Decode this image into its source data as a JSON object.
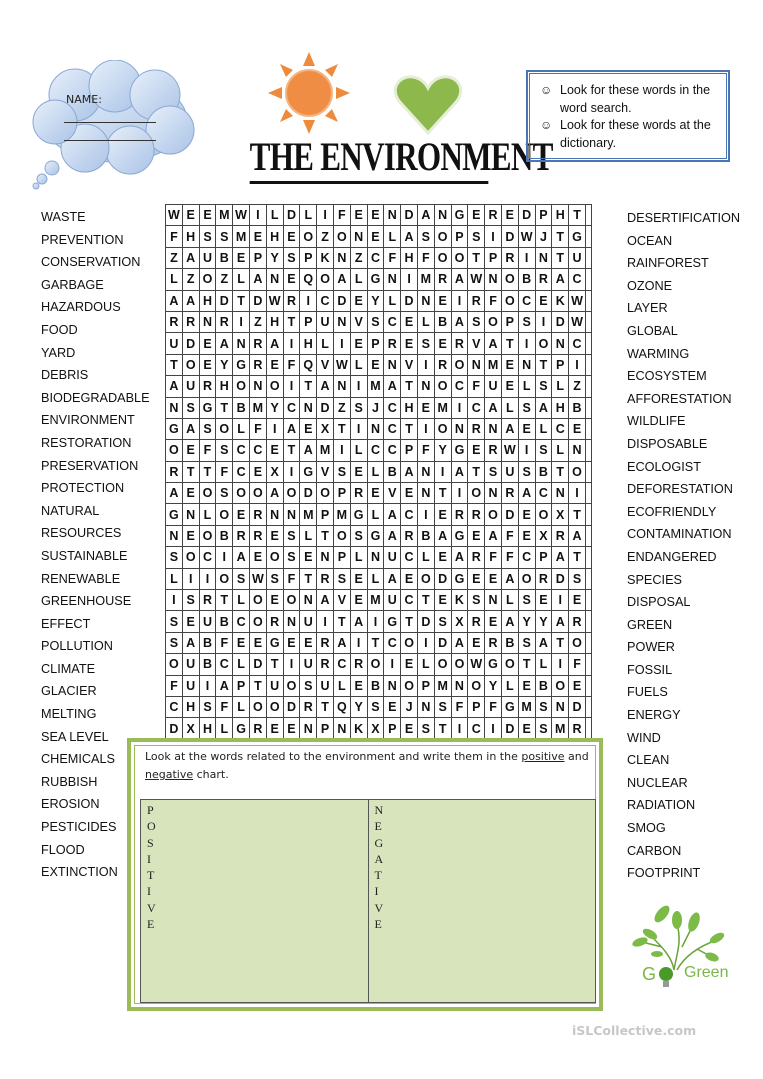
{
  "header": {
    "name_label": "NAME:",
    "title": "THE ENVIRONMENT",
    "instructions": [
      {
        "icon": "smiley-icon",
        "glyph": "☺",
        "text": "Look for these words in the word search."
      },
      {
        "icon": "smiley-icon",
        "glyph": "☺",
        "text": "Look for these words at the dictionary."
      }
    ]
  },
  "left_words": [
    "WASTE",
    "PREVENTION",
    "CONSERVATION",
    "GARBAGE",
    "HAZARDOUS",
    "FOOD",
    "YARD",
    "DEBRIS",
    "BIODEGRADABLE",
    "ENVIRONMENT",
    "RESTORATION",
    "PRESERVATION",
    "PROTECTION",
    "NATURAL",
    "RESOURCES",
    "SUSTAINABLE",
    "RENEWABLE",
    "GREENHOUSE",
    "EFFECT",
    "POLLUTION",
    "CLIMATE",
    "GLACIER",
    "MELTING",
    "SEA LEVEL",
    "CHEMICALS",
    "RUBBISH",
    "EROSION",
    "PESTICIDES",
    "FLOOD",
    "EXTINCTION"
  ],
  "right_words": [
    "DESERTIFICATION",
    "OCEAN",
    "RAINFOREST",
    "OZONE",
    "LAYER",
    "GLOBAL",
    "WARMING",
    "ECOSYSTEM",
    "AFFORESTATION",
    "WILDLIFE",
    "DISPOSABLE",
    "ECOLOGIST",
    "DEFORESTATION",
    "ECOFRIENDLY",
    "CONTAMINATION",
    "ENDANGERED",
    "SPECIES",
    "DISPOSAL",
    "GREEN",
    "POWER",
    "FOSSIL",
    "FUELS",
    "ENERGY",
    "WIND",
    "CLEAN",
    "NUCLEAR",
    "RADIATION",
    "SMOG",
    "CARBON",
    "FOOTPRINT"
  ],
  "grid": [
    "WEEMWILDLIFEENDANGEREDPHT",
    "FHSSMEHEOZONELASOPSIDWJTG",
    "ZAUBEPYSPKNZCFHFOOTPRINTU",
    "LZOZLANEQOALGNIMRAWNOBRAC",
    "AAHDTDWRICDEYLDNEIRFOCEKW",
    "RRNRIZHTPUNVSCELBASOPSIDW",
    "UDEANRAIHLIEPRESERVATIONC",
    "TOEYGREFQVWLENVIRONMENTPI",
    "AURHONOITANIMATNOCFUELSLZ",
    "NSGTBMYCNDZSJCHEMICALSAHB",
    "GASOLFIAEXTINCTIONRNAELCE",
    "OEFSCCETAMILCCPFYGERWISLN",
    "RTTFCEXIGVSELBANIATSUSBTO",
    "AEOSOOAODOPREVENTIONRACNI",
    "GNLOERNNMPMGLACIERRODEOXT",
    "NEOBRRESLTOSGARBAGEAFEXRA",
    "SOCIAEOSENPLNUCLEARFFCPAT",
    "LIIOSWSFTRSELAEODGEEAORDS",
    "ISRTLOEONAVEMUCTEKSNLSEIE",
    "SEUBCORNUITAIGTDSXREAYYAR",
    "SABFEEGEERAITCOIDAERBSATO",
    "OUBCLDTIURCROIELOOWGOTLIF",
    "FUIAPTUOSULEBNOPMNOYLEBOE",
    "CHSFLOODRTQYSEJNSFPFGMSND",
    "DXHLGREENPNKXPESTICIDESMR"
  ],
  "task": {
    "text_before": "Look at the words related to the environment and write them in the ",
    "positive_word": "positive",
    "text_middle": " and ",
    "negative_word": "negative",
    "text_after": " chart.",
    "positive_label": "POSITIVE",
    "negative_label": "NEGATIVE",
    "fill_color": "#d7e4bc",
    "border_color": "#9bbb59"
  },
  "logo": {
    "text": "Go Green",
    "suffix": "Green"
  },
  "watermark": "iSLCollective.com",
  "colors": {
    "sun": "#ee8a3c",
    "heart": "#8cb84c",
    "cloud": "#c9d9ef",
    "instruction_border": "#4a77b4"
  }
}
